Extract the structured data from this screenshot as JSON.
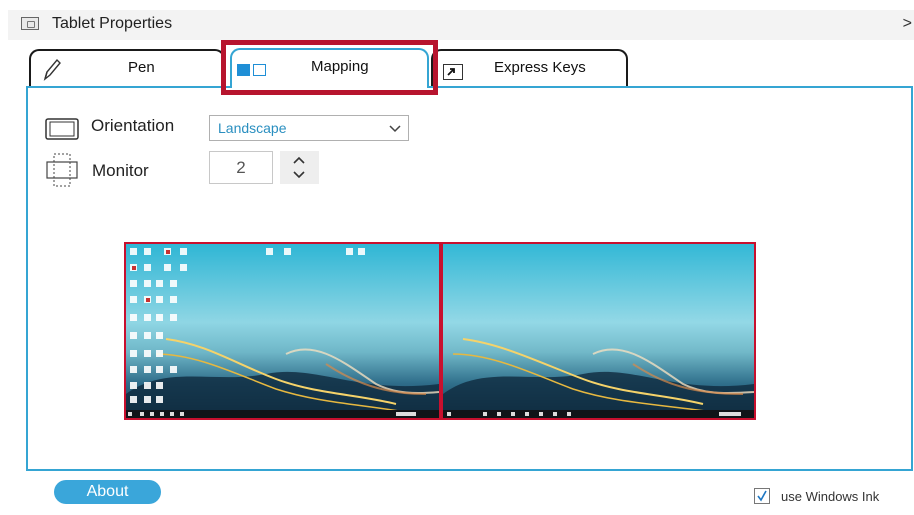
{
  "window": {
    "title": "Tablet Properties",
    "close_glyph": ">"
  },
  "tabs": [
    {
      "label": "Pen",
      "icon": "pen-icon"
    },
    {
      "label": "Mapping",
      "icon": "mapping-icon",
      "active": true
    },
    {
      "label": "Express Keys",
      "icon": "express-keys-icon"
    }
  ],
  "mapping": {
    "orientation_label": "Orientation",
    "orientation_value": "Landscape",
    "monitor_label": "Monitor",
    "monitor_value": "2"
  },
  "footer": {
    "about_label": "About",
    "windows_ink_label": "use Windows Ink",
    "windows_ink_checked": true
  },
  "colors": {
    "accent": "#35a5d3",
    "highlight": "#b7142e",
    "selected_monitor_border": "#c8102e"
  }
}
